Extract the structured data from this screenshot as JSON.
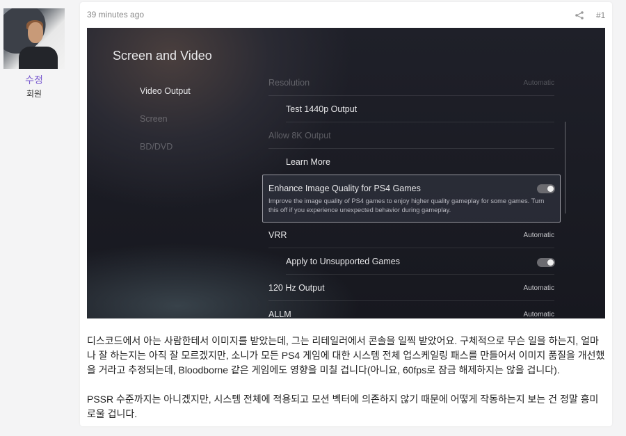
{
  "author": {
    "name": "수정",
    "role": "회원"
  },
  "post": {
    "time": "39 minutes ago",
    "number": "#1",
    "share_icon": "share-icon",
    "paragraphs": [
      "디스코드에서 아는 사람한테서 이미지를 받았는데, 그는 리테일러에서 콘솔을 일찍 받았어요. 구체적으로 무슨 일을 하는지, 얼마나 잘 하는지는 아직 잘 모르겠지만, 소니가 모든 PS4 게임에 대한 시스템 전체 업스케일링 패스를 만들어서 이미지 품질을 개선했을 거라고 추정되는데, Bloodborne 같은 게임에도 영향을 미칠 겁니다(아니요, 60fps로 잠금 해제하지는 않을 겁니다).",
      "PSSR 수준까지는 아니겠지만, 시스템 전체에 적용되고 모션 벡터에 의존하지 않기 때문에 어떻게 작동하는지 보는 건 정말 흥미로울 겁니다."
    ]
  },
  "screenshot": {
    "title": "Screen and Video",
    "menu": [
      "Video Output",
      "Screen",
      "BD/DVD"
    ],
    "rows": {
      "resolution": "Resolution",
      "resolution_val": "Automatic",
      "test": "Test 1440p Output",
      "allow8k": "Allow 8K Output",
      "learn": "Learn More",
      "enhance": "Enhance Image Quality for PS4 Games",
      "enhance_desc": "Improve the image quality of PS4 games to enjoy higher quality gameplay for some games. Turn this off if you experience unexpected behavior during gameplay.",
      "enhance_on": true,
      "vrr": "VRR",
      "vrr_val": "Automatic",
      "apply": "Apply to Unsupported Games",
      "apply_on": true,
      "hz": "120 Hz Output",
      "hz_val": "Automatic",
      "allm": "ALLM",
      "allm_val": "Automatic"
    }
  }
}
